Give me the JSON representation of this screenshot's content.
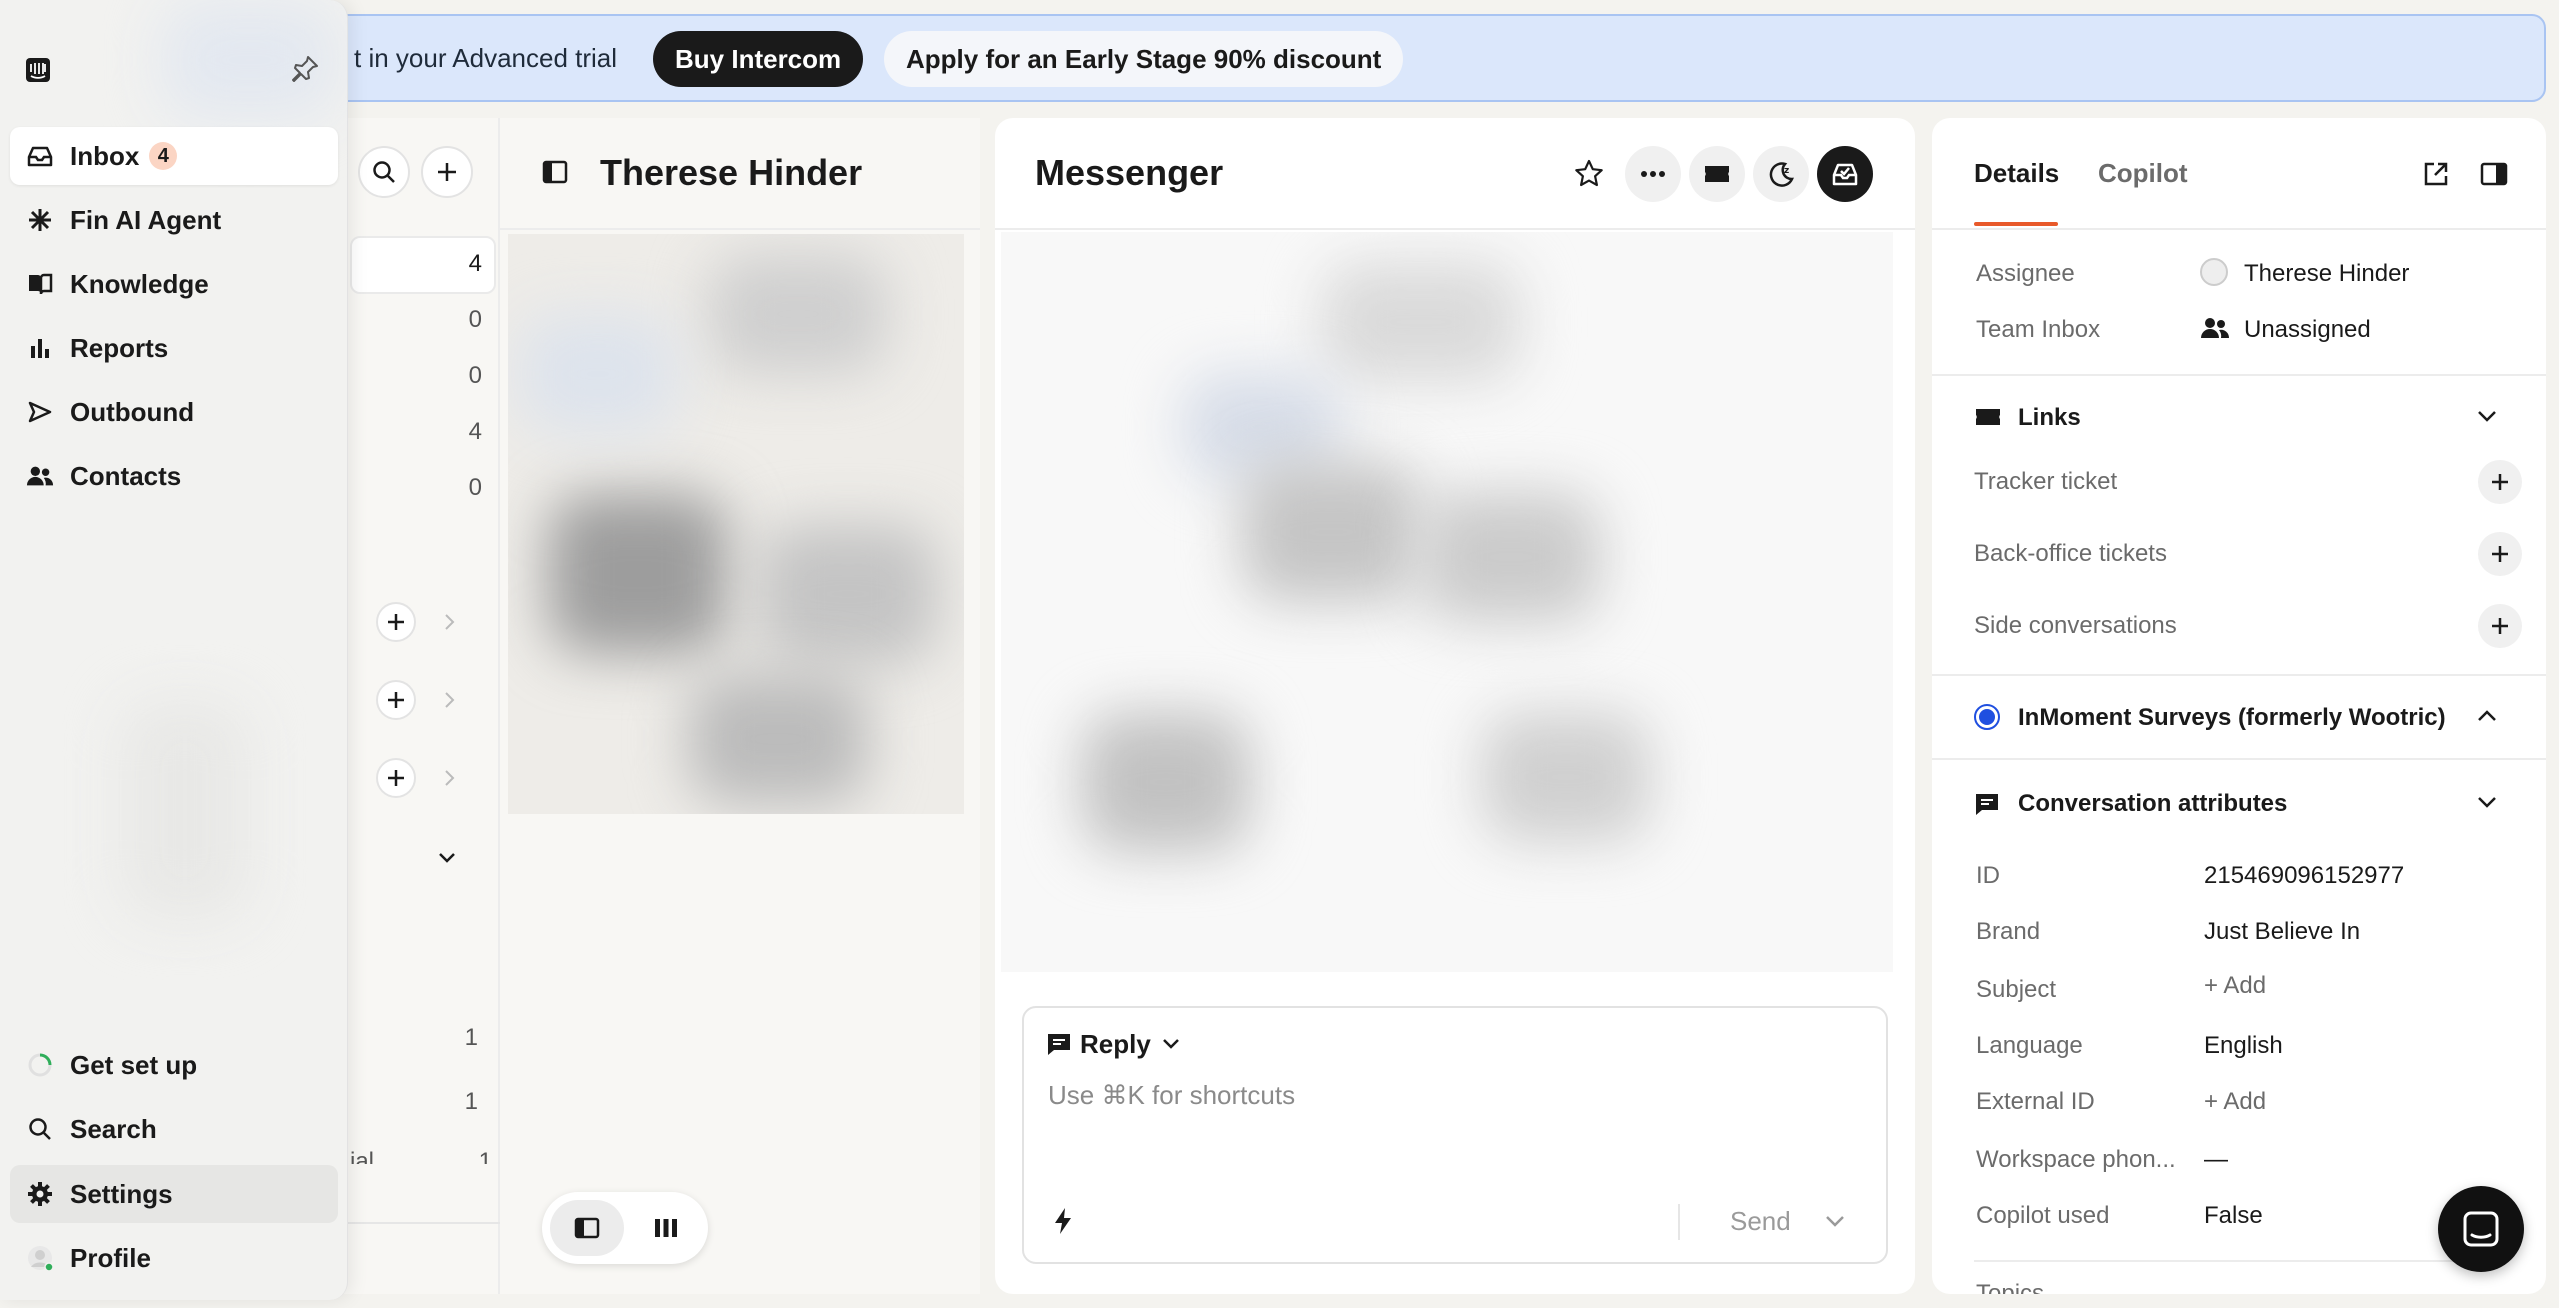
{
  "banner": {
    "text": "t in your Advanced trial",
    "buy_label": "Buy Intercom",
    "apply_label": "Apply for an Early Stage 90% discount"
  },
  "sidebar": {
    "items": [
      {
        "label": "Inbox",
        "badge": "4",
        "icon": "inbox-icon"
      },
      {
        "label": "Fin AI Agent",
        "icon": "fin-icon"
      },
      {
        "label": "Knowledge",
        "icon": "book-icon"
      },
      {
        "label": "Reports",
        "icon": "bar-chart-icon"
      },
      {
        "label": "Outbound",
        "icon": "send-icon"
      },
      {
        "label": "Contacts",
        "icon": "people-icon"
      }
    ],
    "bottom": [
      {
        "label": "Get set up",
        "icon": "progress-icon"
      },
      {
        "label": "Search",
        "icon": "search-icon"
      },
      {
        "label": "Settings",
        "icon": "gear-icon"
      },
      {
        "label": "Profile",
        "icon": "avatar-icon"
      }
    ]
  },
  "list": {
    "counts": [
      "4",
      "0",
      "0",
      "4",
      "0"
    ],
    "sub_counts": [
      "1",
      "1",
      "1"
    ],
    "partial_label": "ial"
  },
  "conversation": {
    "title": "Therese Hinder"
  },
  "messenger": {
    "title": "Messenger",
    "reply_label": "Reply",
    "placeholder": "Use ⌘K for shortcuts",
    "send_label": "Send"
  },
  "details": {
    "tabs": [
      "Details",
      "Copilot"
    ],
    "assignee_label": "Assignee",
    "assignee_value": "Therese Hinder",
    "team_label": "Team Inbox",
    "team_value": "Unassigned",
    "links_title": "Links",
    "links": [
      "Tracker ticket",
      "Back-office tickets",
      "Side conversations"
    ],
    "inmoment_title": "InMoment Surveys (formerly Wootric)",
    "attributes_title": "Conversation attributes",
    "attributes": [
      {
        "label": "ID",
        "value": "215469096152977"
      },
      {
        "label": "Brand",
        "value": "Just Believe In"
      },
      {
        "label": "Subject",
        "value": "+ Add"
      },
      {
        "label": "Language",
        "value": "English"
      },
      {
        "label": "External ID",
        "value": "+ Add"
      },
      {
        "label": "Workspace phon...",
        "value": "—"
      },
      {
        "label": "Copilot used",
        "value": "False"
      }
    ],
    "partial_label": "Topics"
  },
  "colors": {
    "accent": "#e8592a",
    "banner_bg": "#dbe7fb",
    "badge_bg": "#fbd5c4",
    "inmoment_dot": "#1f4fe0"
  }
}
